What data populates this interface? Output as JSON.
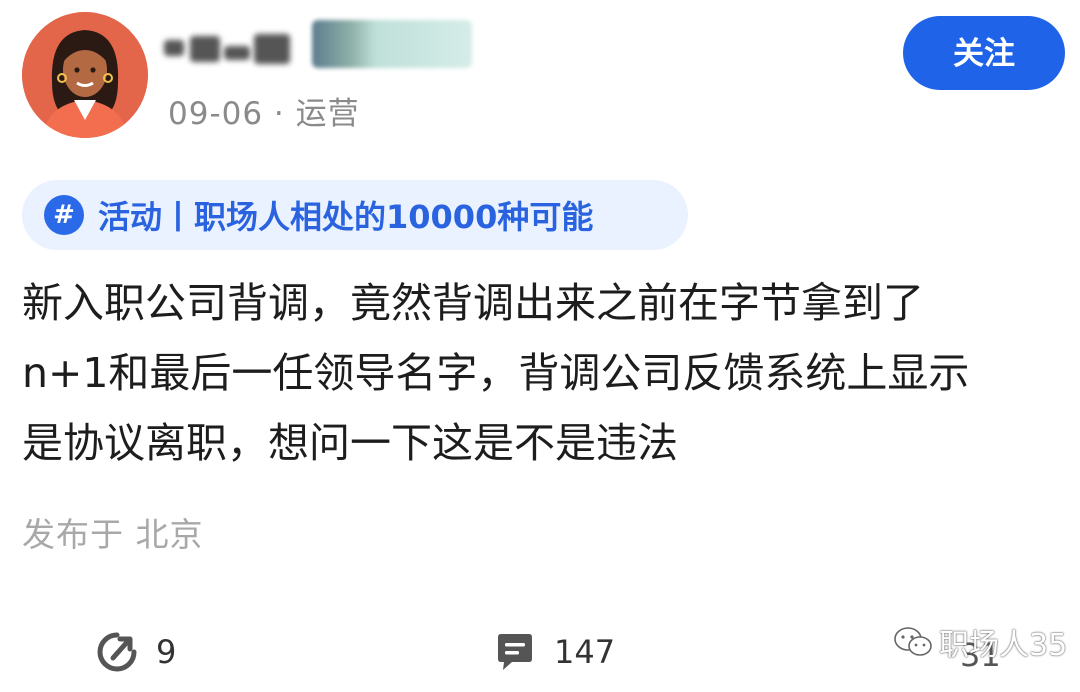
{
  "header": {
    "meta": "09-06 · 运营",
    "follow_label": "关注",
    "avatar_icon": "user-avatar-icon"
  },
  "topic": {
    "icon": "hash-icon",
    "hash_symbol": "#",
    "label": "活动丨职场人相处的10000种可能"
  },
  "post": {
    "lines": [
      "新入职公司背调，竟然背调出来之前在字节拿到了",
      "n+1和最后一任领导名字，背调公司反馈系统上显示",
      "是协议离职，想问一下这是不是违法"
    ],
    "location": "发布于 北京"
  },
  "actions": {
    "share_count": "9",
    "comment_count": "147",
    "like_count": "31"
  },
  "watermark": {
    "text": "职场人35"
  },
  "colors": {
    "accent": "#1f64e8",
    "topic_bg": "#eaf1ff",
    "meta_gray": "#8a8a8a"
  }
}
